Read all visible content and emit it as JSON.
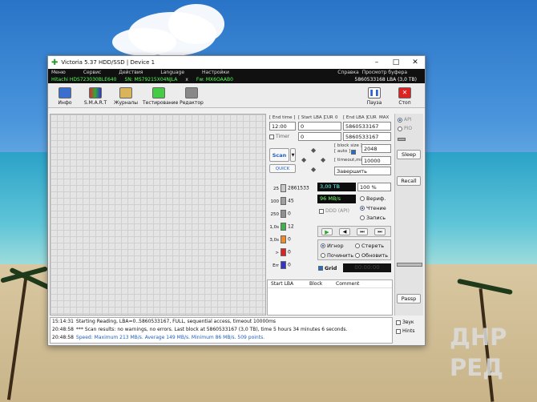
{
  "window": {
    "title": "Victoria 5.37 HDD/SSD | Device 1",
    "controls": [
      "–",
      "□",
      "✕"
    ]
  },
  "menu": {
    "items": [
      "Меню",
      "Сервис",
      "Действия",
      "Language",
      "Настройки",
      "Справка"
    ],
    "buffer": "Просмотр буфера"
  },
  "info": {
    "model": "Hitachi HDS723030BLE640",
    "sn": "SN: MS79215X04NJLA",
    "x": "x",
    "fw": "Fw: MX6OAAB0",
    "lba": "5860533168 LBA (3,0 TB)"
  },
  "toolbar": {
    "info": "Инфо",
    "smart": "S.M.A.R.T",
    "logs": "Журналы",
    "test": "Тестирование",
    "editor": "Редактор",
    "pause": "Пауза",
    "stop": "Стоп"
  },
  "panel": {
    "end_time_label": "[ End time ]",
    "start_lba_label": "[ Start LBA ]",
    "cur_label": "CUR",
    "zero": "0",
    "end_lba_label": "[ End LBA ]",
    "cur2": "CUR",
    "max": "MAX",
    "time_value": "12:00",
    "start_lba": "0",
    "end_lba": "5860533167",
    "timer_label": "Timer",
    "timer_value": "0",
    "end_lba2": "5860533167",
    "scan": "Scan",
    "quick": "QUICK",
    "block_size_label": "[ block size ]",
    "auto_label": "[ auto ]",
    "block_size": "2048",
    "timeout_label": "[ timeout,ms ]",
    "timeout": "10000",
    "finish": "Завершить",
    "capacity": "3,00 TB",
    "percent": "100",
    "percent_sign": "%",
    "speed": "96 MB/s",
    "verify": "Вериф.",
    "read": "Чтение",
    "write": "Запись",
    "ddd": "DDD (API)",
    "ignore": "Игнор",
    "erase": "Стереть",
    "repair": "Починить",
    "refresh": "Обновить",
    "grid": "Grid",
    "timer_display": "00:00:00"
  },
  "bars": [
    {
      "label": "25",
      "count": "2861533",
      "color": "#c8c8c8"
    },
    {
      "label": "100",
      "count": "45",
      "color": "#a0a0a0"
    },
    {
      "label": "250",
      "count": "0",
      "color": "#909090"
    },
    {
      "label": "1,0s",
      "count": "12",
      "color": "#3cb44b"
    },
    {
      "label": "3,0s",
      "count": "0",
      "color": "#f08a24"
    },
    {
      "label": ">",
      "count": "0",
      "color": "#d22"
    },
    {
      "label": "Err",
      "count": "0",
      "color": "#33c"
    }
  ],
  "table": {
    "col1": "Start LBA",
    "col2": "Block",
    "col3": "Comment"
  },
  "sidebar": {
    "api": "API",
    "pio": "PIO",
    "sleep": "Sleep",
    "recall": "Recall",
    "passp": "Passp",
    "sound": "Звук",
    "hints": "Hints"
  },
  "log": [
    {
      "time": "15:14:31",
      "text": "Starting Reading, LBA=0..5860533167, FULL, sequential access, timeout 10000ms"
    },
    {
      "time": "20:48:58",
      "text": "*** Scan results: no warnings, no errors. Last block at 5860533167 (3,0 TB), time 5 hours 34 minutes 6 seconds."
    },
    {
      "time": "20:48:58",
      "text": "Speed: Maximum 213 MB/s. Average 149 MB/s. Minimum 86 MB/s. 509 points."
    }
  ],
  "watermark": {
    "line1": "ДНР",
    "line2": "РЕД"
  }
}
